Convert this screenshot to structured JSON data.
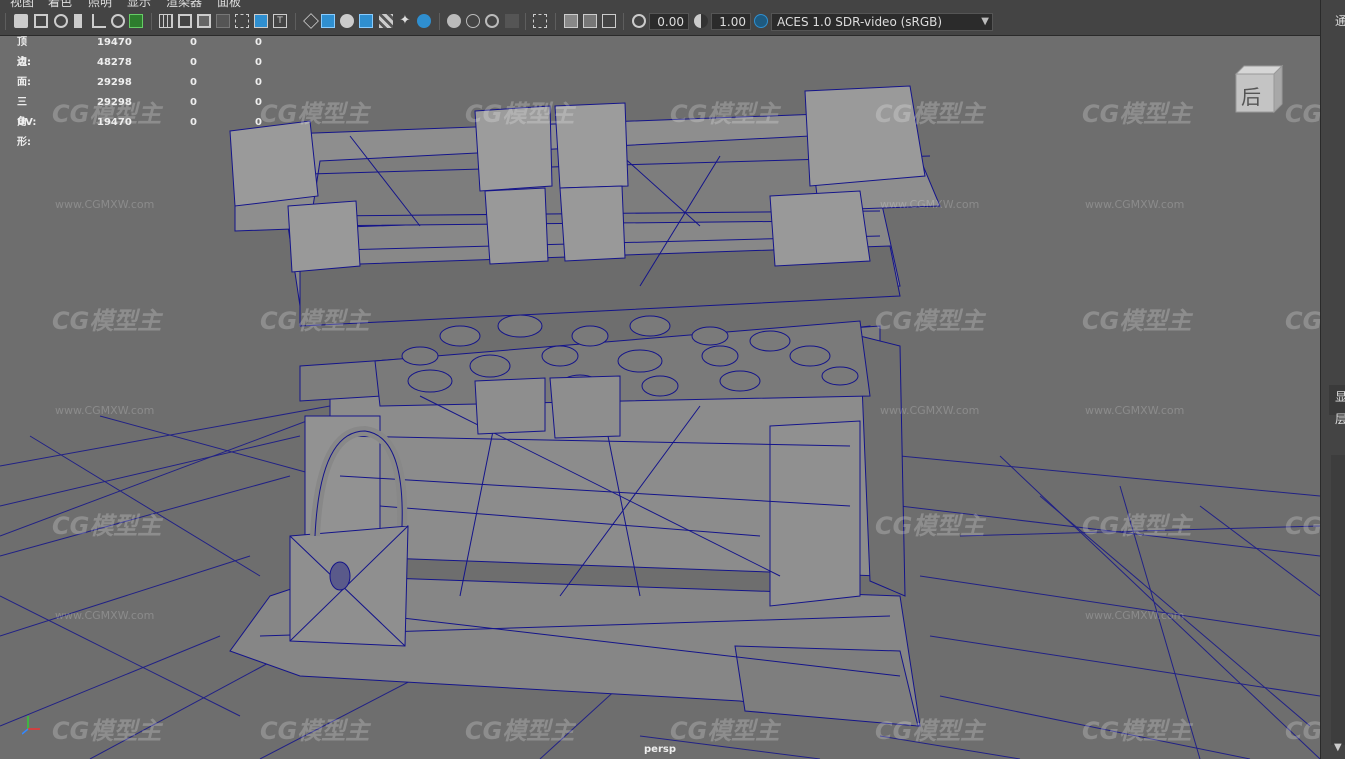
{
  "menu": [
    "视图",
    "着色",
    "照明",
    "显示",
    "渲染器",
    "面板"
  ],
  "toolbar": {
    "exposure_value": "0.00",
    "gamma_value": "1.00",
    "color_space": "ACES 1.0 SDR-video (sRGB)"
  },
  "hud": {
    "rows": [
      {
        "label": "顶点:",
        "v1": "19470",
        "v2": "0",
        "v3": "0"
      },
      {
        "label": "边:",
        "v1": "48278",
        "v2": "0",
        "v3": "0"
      },
      {
        "label": "面:",
        "v1": "29298",
        "v2": "0",
        "v3": "0"
      },
      {
        "label": "三角形:",
        "v1": "29298",
        "v2": "0",
        "v3": "0"
      },
      {
        "label": "UV:",
        "v1": "19470",
        "v2": "0",
        "v3": "0"
      }
    ]
  },
  "viewcube_label": "后",
  "camera_label": "persp",
  "watermark": {
    "logo": "CG模型主",
    "url": "www.CGMXW.com"
  },
  "right_panel": [
    "通",
    "显",
    "层"
  ],
  "colors": {
    "wire": "#1a1a8c",
    "mesh": "#8a8a8a",
    "viewport": "#6e6e6e",
    "accent": "#2f8fd0"
  }
}
